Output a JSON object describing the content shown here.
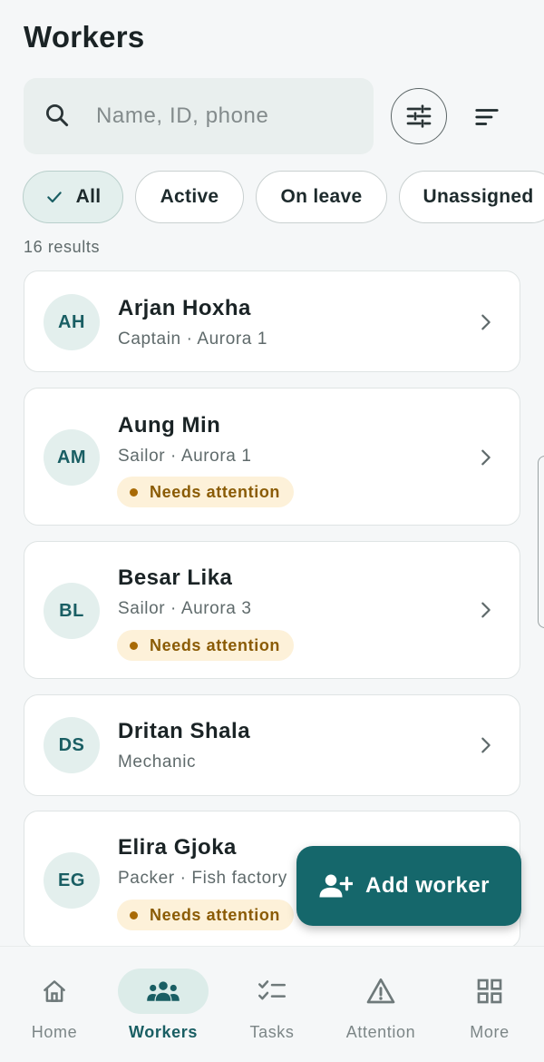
{
  "header": {
    "title": "Workers"
  },
  "search": {
    "placeholder": "Name, ID, phone",
    "value": ""
  },
  "filters": [
    {
      "label": "All",
      "selected": true
    },
    {
      "label": "Active",
      "selected": false
    },
    {
      "label": "On leave",
      "selected": false
    },
    {
      "label": "Unassigned",
      "selected": false
    }
  ],
  "results_label": "16 results",
  "workers": [
    {
      "initials": "AH",
      "name": "Arjan Hoxha",
      "subtitle": "Captain · Aurora 1",
      "badge": ""
    },
    {
      "initials": "AM",
      "name": "Aung Min",
      "subtitle": "Sailor · Aurora 1",
      "badge": "Needs attention"
    },
    {
      "initials": "BL",
      "name": "Besar Lika",
      "subtitle": "Sailor · Aurora 3",
      "badge": "Needs attention"
    },
    {
      "initials": "DS",
      "name": "Dritan Shala",
      "subtitle": "Mechanic",
      "badge": ""
    },
    {
      "initials": "EG",
      "name": "Elira Gjoka",
      "subtitle": "Packer · Fish factory",
      "badge": "Needs attention"
    }
  ],
  "fab": {
    "label": "Add worker",
    "icon": "person-add-icon"
  },
  "nav": [
    {
      "label": "Home",
      "icon": "home-icon",
      "active": false
    },
    {
      "label": "Workers",
      "icon": "groups-icon",
      "active": true
    },
    {
      "label": "Tasks",
      "icon": "checklist-icon",
      "active": false
    },
    {
      "label": "Attention",
      "icon": "warning-icon",
      "active": false
    },
    {
      "label": "More",
      "icon": "grid-icon",
      "active": false
    }
  ],
  "colors": {
    "primary": "#15676b",
    "badge_bg": "#fdf1d9",
    "badge_text": "#8a5b05",
    "chip_selected_bg": "#e3efed"
  }
}
